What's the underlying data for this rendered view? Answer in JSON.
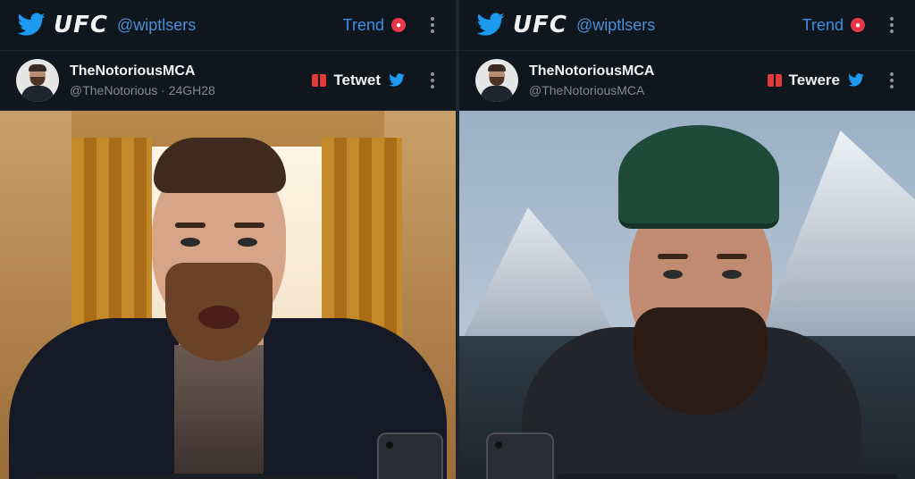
{
  "panels": [
    {
      "brand": "UFC",
      "handle": "@wiptlsers",
      "trend_label": "Trend",
      "display_name": "TheNotoriousMCA",
      "sub_handle": "@TheNotorious · 24GH28",
      "tweet_label": "Tetwet"
    },
    {
      "brand": "UFC",
      "handle": "@wiptlsers",
      "trend_label": "Trend",
      "display_name": "TheNotoriousMCA",
      "sub_handle": "@TheNotoriousMCA",
      "tweet_label": "Tewere"
    }
  ],
  "colors": {
    "twitter_blue": "#1d9bf0",
    "trend_badge": "#e5384a",
    "background": "#0d1117"
  },
  "icons": [
    "bird-icon",
    "more-vert-icon",
    "bookmark-icon",
    "phone-icon"
  ]
}
